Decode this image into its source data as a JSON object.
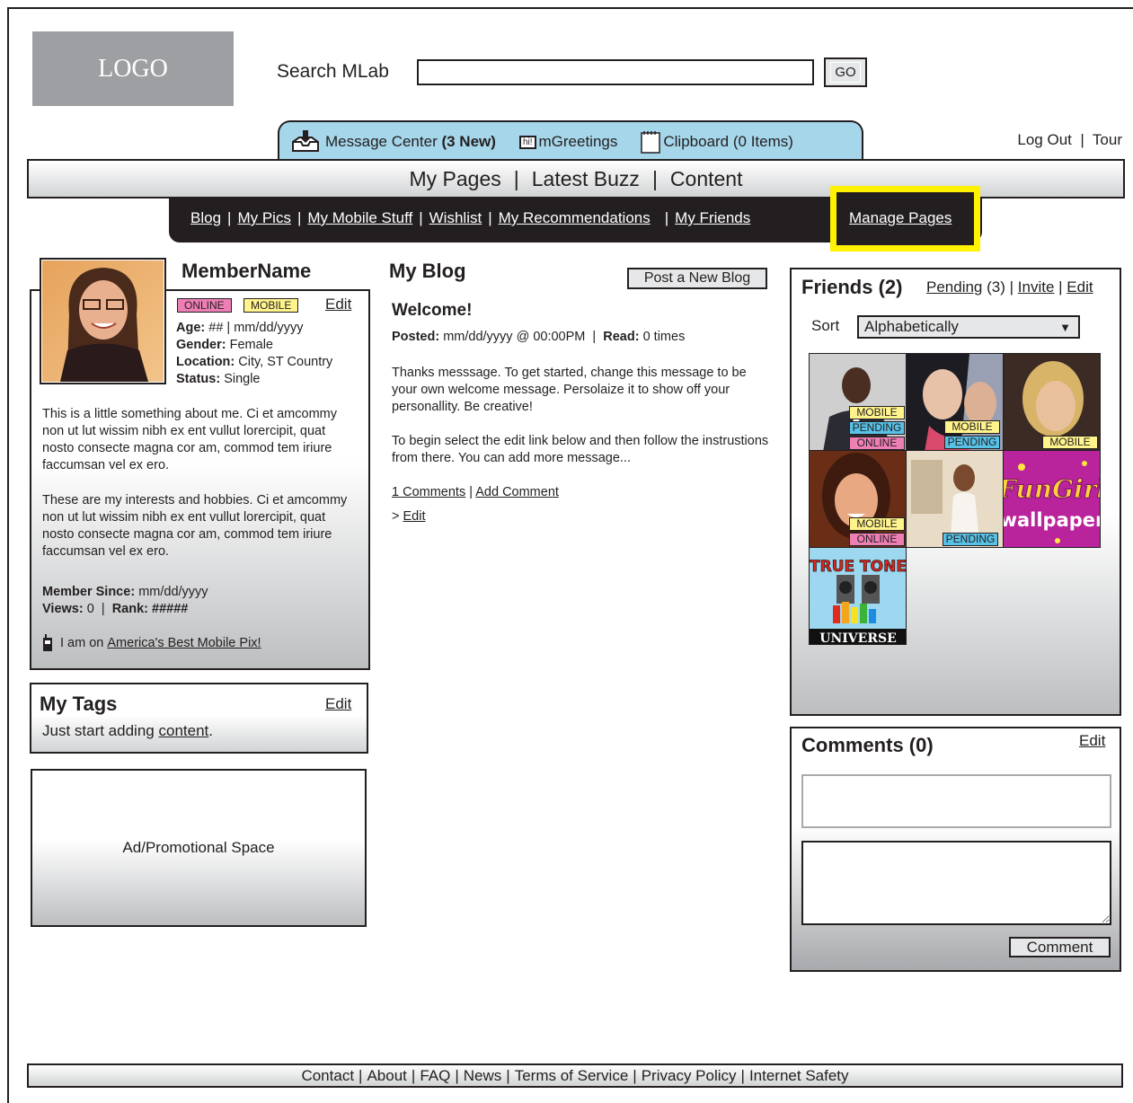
{
  "header": {
    "logo": "LOGO",
    "search_label": "Search MLab",
    "search_value": "",
    "go_label": "GO"
  },
  "utility": {
    "message_center_label": "Message Center",
    "message_center_count": "(3 New)",
    "greetings_icon_text": "hi!",
    "greetings_label": "mGreetings",
    "clipboard_label": "Clipboard (0 Items)",
    "logout_label": "Log Out",
    "tour_label": "Tour"
  },
  "main_nav": {
    "items": [
      "My Pages",
      "Latest Buzz",
      "Content"
    ]
  },
  "sub_nav": {
    "items": [
      "Blog",
      "My Pics",
      "My Mobile Stuff",
      "Wishlist",
      "My Recommendations",
      "My Friends"
    ],
    "manage_pages": "Manage Pages",
    "highlight_color": "#fff200"
  },
  "profile": {
    "member_name": "MemberName",
    "badge_online": "ONLINE",
    "badge_mobile": "MOBILE",
    "edit_label": "Edit",
    "age_label": "Age:",
    "age_value": "## | mm/dd/yyyy",
    "gender_label": "Gender:",
    "gender_value": "Female",
    "location_label": "Location:",
    "location_value": "City, ST Country",
    "status_label": "Status:",
    "status_value": "Single",
    "about": "This is a little something about me. Ci et amcommy non ut lut wissim nibh ex ent vullut lorercipit, quat nosto consecte magna cor am, commod tem iriure faccumsan vel ex ero.",
    "hobbies": "These are my interests and hobbies. Ci et amcommy non ut lut wissim nibh ex ent vullut lorercipit, quat nosto consecte magna cor am, commod tem iriure faccumsan vel ex ero.",
    "member_since_label": "Member Since:",
    "member_since_value": "mm/dd/yyyy",
    "views_label": "Views:",
    "views_value": "0",
    "rank_label": "Rank:",
    "rank_value": "#####",
    "mobile_prefix": "I am on",
    "mobile_link": "America's Best Mobile Pix!"
  },
  "tags": {
    "title": "My Tags",
    "edit_label": "Edit",
    "text_prefix": "Just start adding",
    "content_link": "content",
    "text_suffix": "."
  },
  "ad": {
    "label": "Ad/Promotional Space"
  },
  "blog": {
    "title": "My Blog",
    "post_button": "Post a New Blog",
    "post_title": "Welcome!",
    "posted_label": "Posted:",
    "posted_value": "mm/dd/yyyy @ 00:00PM",
    "read_label": "Read:",
    "read_value": "0 times",
    "body1": "Thanks messsage. To get started, change this message to be your own welcome message. Persolaize it to show off your personallity. Be creative!",
    "body2": "To begin select the edit link below and then follow the instrustions from there. You can add more message...",
    "comments_link": "1 Comments",
    "add_comment_link": "Add Comment",
    "edit_prefix": ">",
    "edit_link": "Edit"
  },
  "friends": {
    "title": "Friends (2)",
    "pending_link": "Pending",
    "pending_count": "(3)",
    "invite_link": "Invite",
    "edit_link": "Edit",
    "sort_label": "Sort",
    "sort_value": "Alphabetically",
    "thumbs": [
      {
        "badges": [
          "MOBILE",
          "PENDING",
          "ONLINE"
        ]
      },
      {
        "badges": [
          "MOBILE",
          "PENDING"
        ]
      },
      {
        "badges": [
          "MOBILE"
        ]
      },
      {
        "badges": [
          "MOBILE",
          "ONLINE"
        ]
      },
      {
        "badges": [
          "PENDING"
        ]
      },
      {
        "badges": [],
        "wallpaper_line1": "FunGirl",
        "wallpaper_line2": "wallpaper"
      },
      {
        "badges": [],
        "ringtone_line1": "TRUE TONE",
        "ringtone_line2": "UNIVERSE"
      }
    ]
  },
  "comments": {
    "title": "Comments (0)",
    "edit_label": "Edit",
    "name_value": "",
    "body_value": "",
    "button_label": "Comment"
  },
  "footer": {
    "links": [
      "Contact",
      "About",
      "FAQ",
      "News",
      "Terms of Service",
      "Privacy Policy",
      "Internet Safety"
    ]
  },
  "colors": {
    "online": "#ee7fb5",
    "mobile": "#fff48c",
    "pending": "#58c1e6",
    "tab_blue": "#a6d6ea"
  }
}
